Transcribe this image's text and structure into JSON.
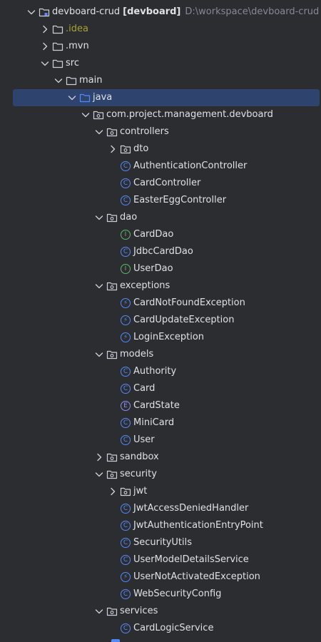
{
  "colors": {
    "background": "#2b2d30",
    "text": "#dfe1e5",
    "muted": "#868a91",
    "selection": "#2e436e",
    "folder_yellow": "#a8a232",
    "class_blue": "#548af7",
    "interface_green": "#5fb865",
    "enum_purple": "#8d8df5",
    "chevron": "#ced0d6"
  },
  "project": {
    "name": "devboard-crud",
    "module": "[devboard]",
    "path": "D:\\workspace\\devboard-crud"
  },
  "tree": [
    {
      "label": "devboard-crud",
      "level": 0,
      "kind": "project",
      "chevron": "down"
    },
    {
      "label": ".idea",
      "level": 1,
      "kind": "folder",
      "chevron": "right",
      "color": "yellow"
    },
    {
      "label": ".mvn",
      "level": 1,
      "kind": "folder",
      "chevron": "right"
    },
    {
      "label": "src",
      "level": 1,
      "kind": "folder",
      "chevron": "down"
    },
    {
      "label": "main",
      "level": 2,
      "kind": "folder",
      "chevron": "down"
    },
    {
      "label": "java",
      "level": 3,
      "kind": "source-folder",
      "chevron": "down",
      "selected": true
    },
    {
      "label": "com.project.management.devboard",
      "level": 4,
      "kind": "package",
      "chevron": "down"
    },
    {
      "label": "controllers",
      "level": 5,
      "kind": "package",
      "chevron": "down"
    },
    {
      "label": "dto",
      "level": 6,
      "kind": "package",
      "chevron": "right"
    },
    {
      "label": "AuthenticationController",
      "level": 6,
      "kind": "class",
      "chevron": "none"
    },
    {
      "label": "CardController",
      "level": 6,
      "kind": "class",
      "chevron": "none"
    },
    {
      "label": "EasterEggController",
      "level": 6,
      "kind": "class",
      "chevron": "none"
    },
    {
      "label": "dao",
      "level": 5,
      "kind": "package",
      "chevron": "down"
    },
    {
      "label": "CardDao",
      "level": 6,
      "kind": "interface",
      "chevron": "none"
    },
    {
      "label": "JdbcCardDao",
      "level": 6,
      "kind": "class",
      "chevron": "none"
    },
    {
      "label": "UserDao",
      "level": 6,
      "kind": "interface",
      "chevron": "none"
    },
    {
      "label": "exceptions",
      "level": 5,
      "kind": "package",
      "chevron": "down"
    },
    {
      "label": "CardNotFoundException",
      "level": 6,
      "kind": "exception",
      "chevron": "none"
    },
    {
      "label": "CardUpdateException",
      "level": 6,
      "kind": "exception",
      "chevron": "none"
    },
    {
      "label": "LoginException",
      "level": 6,
      "kind": "exception",
      "chevron": "none"
    },
    {
      "label": "models",
      "level": 5,
      "kind": "package",
      "chevron": "down"
    },
    {
      "label": "Authority",
      "level": 6,
      "kind": "class",
      "chevron": "none"
    },
    {
      "label": "Card",
      "level": 6,
      "kind": "class",
      "chevron": "none"
    },
    {
      "label": "CardState",
      "level": 6,
      "kind": "enum",
      "chevron": "none"
    },
    {
      "label": "MiniCard",
      "level": 6,
      "kind": "class",
      "chevron": "none"
    },
    {
      "label": "User",
      "level": 6,
      "kind": "class",
      "chevron": "none"
    },
    {
      "label": "sandbox",
      "level": 5,
      "kind": "package",
      "chevron": "right"
    },
    {
      "label": "security",
      "level": 5,
      "kind": "package",
      "chevron": "down"
    },
    {
      "label": "jwt",
      "level": 6,
      "kind": "package",
      "chevron": "right"
    },
    {
      "label": "JwtAccessDeniedHandler",
      "level": 6,
      "kind": "class",
      "chevron": "none"
    },
    {
      "label": "JwtAuthenticationEntryPoint",
      "level": 6,
      "kind": "class",
      "chevron": "none"
    },
    {
      "label": "SecurityUtils",
      "level": 6,
      "kind": "class",
      "chevron": "none"
    },
    {
      "label": "UserModelDetailsService",
      "level": 6,
      "kind": "class",
      "chevron": "none"
    },
    {
      "label": "UserNotActivatedException",
      "level": 6,
      "kind": "exception",
      "chevron": "none"
    },
    {
      "label": "WebSecurityConfig",
      "level": 6,
      "kind": "class",
      "chevron": "none"
    },
    {
      "label": "services",
      "level": 5,
      "kind": "package",
      "chevron": "down"
    },
    {
      "label": "CardLogicService",
      "level": 6,
      "kind": "class",
      "chevron": "none"
    }
  ]
}
